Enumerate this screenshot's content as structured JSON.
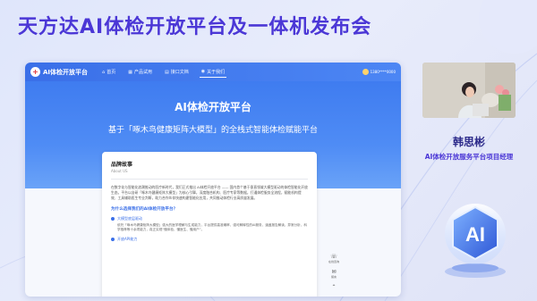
{
  "event": {
    "title": "天方达AI体检开放平台及一体机发布会"
  },
  "site": {
    "brand": "AI体检开放平台",
    "nav": [
      {
        "icon": "⌂",
        "label": "首页"
      },
      {
        "icon": "▦",
        "label": "产品试用"
      },
      {
        "icon": "▤",
        "label": "接口文档"
      },
      {
        "icon": "◉",
        "label": "关于我们"
      }
    ],
    "user_label": "1380****0000",
    "hero": {
      "title": "AI体检开放平台",
      "subtitle": "基于「啄木鸟健康矩阵大模型」的全栈式智能体检赋能平台"
    },
    "card": {
      "title": "品牌故事",
      "title_en": "About US",
      "paragraph": "在数字化与智能化浪潮推动的医疗新时代，我们正式推出 AI体检开放平台 —— 国内首个基于垂直领域大模型驱动的体检智能化开放生态。平台以自研「啄木鸟健康矩阵大模型」为核心引擎，深度融合机构、医疗专家等数据，打通体检服务全流程，赋能机构提效、工具辅助医生专业判断，助力合作伙伴快速构建智能化应用，共同推动体检行业高质量发展。",
      "question": "为什么选择我们的AI体检开放平台？",
      "features": [
        {
          "title": "大模型底层驱动",
          "desc": "依托「啄木鸟健康矩阵大模型」强大的医学理解与生成能力，平台提供高准确率、强可解释性的AI服务，涵盖报告解读、异常分析、科学推荐等十余项能力，真正实现“懂体检、懂医生、懂用户”。"
        },
        {
          "title": "开放API能力",
          "desc": ""
        }
      ]
    },
    "tools": [
      {
        "icon": "☏",
        "label": "在线咨询"
      },
      {
        "icon": "✉",
        "label": "留言"
      },
      {
        "icon": "⌃",
        "label": ""
      }
    ]
  },
  "speaker": {
    "name": "韩思彬",
    "role": "AI体检开放服务平台项目经理"
  },
  "badge": {
    "text": "AI"
  }
}
